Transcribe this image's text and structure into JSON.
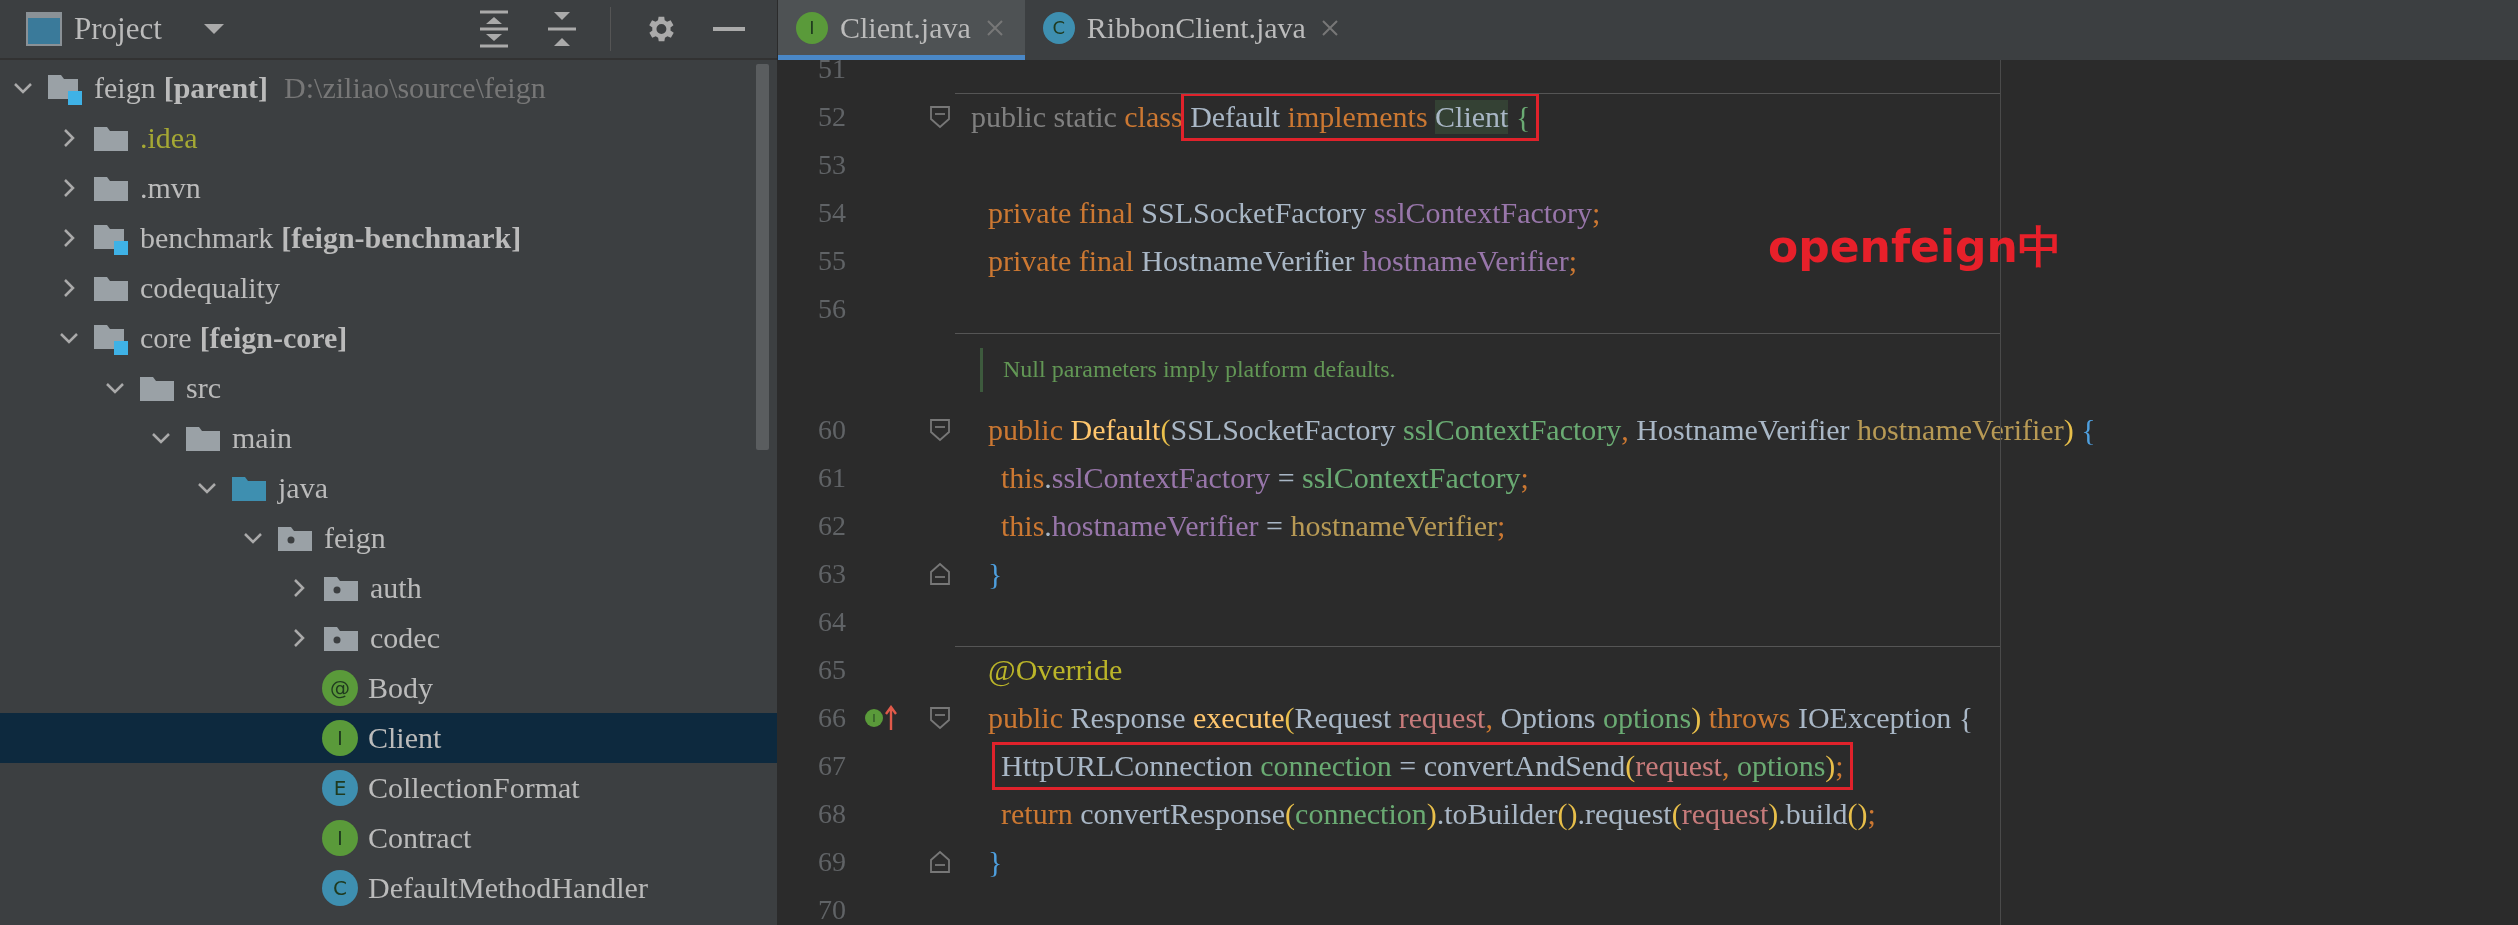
{
  "project_panel": {
    "title": "Project",
    "tree": [
      {
        "name": "feign",
        "module": "[parent]",
        "path": "D:\\ziliao\\source\\feign",
        "kind": "module",
        "expanded": true,
        "selected": false,
        "ignored": false,
        "children": [
          {
            "name": ".idea",
            "kind": "folder",
            "expanded": false,
            "selected": false,
            "ignored": true
          },
          {
            "name": ".mvn",
            "kind": "folder",
            "expanded": false,
            "selected": false,
            "ignored": false
          },
          {
            "name": "benchmark",
            "module": "[feign-benchmark]",
            "kind": "module",
            "expanded": false,
            "selected": false,
            "ignored": false
          },
          {
            "name": "codequality",
            "kind": "folder",
            "expanded": false,
            "selected": false,
            "ignored": false
          },
          {
            "name": "core",
            "module": "[feign-core]",
            "kind": "module",
            "expanded": true,
            "selected": false,
            "ignored": false,
            "children": [
              {
                "name": "src",
                "kind": "folder",
                "expanded": true,
                "selected": false,
                "ignored": false,
                "children": [
                  {
                    "name": "main",
                    "kind": "folder",
                    "expanded": true,
                    "selected": false,
                    "ignored": false,
                    "children": [
                      {
                        "name": "java",
                        "kind": "source_root",
                        "expanded": true,
                        "selected": false,
                        "ignored": false,
                        "children": [
                          {
                            "name": "feign",
                            "kind": "package",
                            "expanded": true,
                            "selected": false,
                            "ignored": false,
                            "children": [
                              {
                                "name": "auth",
                                "kind": "package",
                                "expanded": false,
                                "selected": false,
                                "ignored": false
                              },
                              {
                                "name": "codec",
                                "kind": "package",
                                "expanded": false,
                                "selected": false,
                                "ignored": false
                              },
                              {
                                "name": "Body",
                                "kind": "annotation",
                                "badge": "@",
                                "selected": false,
                                "ignored": false
                              },
                              {
                                "name": "Client",
                                "kind": "interface",
                                "badge": "I",
                                "selected": true,
                                "ignored": false
                              },
                              {
                                "name": "CollectionFormat",
                                "kind": "enum",
                                "badge": "E",
                                "selected": false,
                                "ignored": false
                              },
                              {
                                "name": "Contract",
                                "kind": "interface",
                                "badge": "I",
                                "selected": false,
                                "ignored": false
                              },
                              {
                                "name": "DefaultMethodHandler",
                                "kind": "class",
                                "badge": "C",
                                "selected": false,
                                "ignored": false
                              }
                            ]
                          }
                        ]
                      }
                    ]
                  }
                ]
              }
            ]
          }
        ]
      }
    ]
  },
  "editor": {
    "tabs": [
      {
        "label": "Client.java",
        "badge": "I",
        "kind": "interface",
        "selected": true
      },
      {
        "label": "RibbonClient.java",
        "badge": "C",
        "kind": "class",
        "selected": false
      }
    ],
    "note": "openfeign中",
    "lines": [
      {
        "number": "51",
        "kind": "blank"
      },
      {
        "number": "52",
        "kind": "declaration",
        "separator": true,
        "fold_start": true,
        "fold_end": false,
        "segments": [
          {
            "boxed": false,
            "tokens": [
              {
                "text": "public static ",
                "kind": "dim"
              },
              {
                "text": "class ",
                "kind": "keyword"
              }
            ]
          },
          {
            "boxed": true,
            "tokens": [
              {
                "text": "Default ",
                "kind": "plain"
              },
              {
                "text": "implements ",
                "kind": "keyword"
              },
              {
                "text": "Client",
                "kind": "usage"
              },
              {
                "text": " {",
                "kind": "brace_green"
              }
            ]
          }
        ]
      },
      {
        "number": "53",
        "kind": "blank",
        "separator": false
      },
      {
        "number": "54",
        "kind": "member",
        "separator": false,
        "segments": [
          {
            "boxed": false,
            "tokens": [
              {
                "text": "private final ",
                "kind": "keyword"
              },
              {
                "text": "SSLSocketFactory ",
                "kind": "plain"
              },
              {
                "text": "sslContextFactory",
                "kind": "field"
              },
              {
                "text": ";",
                "kind": "keyword"
              }
            ]
          }
        ]
      },
      {
        "number": "55",
        "kind": "member",
        "separator": false,
        "segments": [
          {
            "boxed": false,
            "tokens": [
              {
                "text": "private final ",
                "kind": "keyword"
              },
              {
                "text": "HostnameVerifier ",
                "kind": "plain"
              },
              {
                "text": "hostnameVerifier",
                "kind": "field"
              },
              {
                "text": ";",
                "kind": "keyword"
              }
            ]
          }
        ]
      },
      {
        "number": "56",
        "kind": "blank",
        "separator": false
      },
      {
        "kind": "doc",
        "separator": true,
        "text": "Null parameters imply platform defaults."
      },
      {
        "number": "60",
        "kind": "member",
        "separator": false,
        "fold_start": true,
        "fold_end": false,
        "segments": [
          {
            "boxed": false,
            "tokens": [
              {
                "text": "public ",
                "kind": "keyword"
              },
              {
                "text": "Default",
                "kind": "method"
              },
              {
                "text": "(",
                "kind": "bracket"
              },
              {
                "text": "SSLSocketFactory ",
                "kind": "plain"
              },
              {
                "text": "sslContextFactory",
                "kind": "green"
              },
              {
                "text": ", ",
                "kind": "keyword"
              },
              {
                "text": "HostnameVerifier ",
                "kind": "plain"
              },
              {
                "text": "hostnameVerifier",
                "kind": "gold"
              },
              {
                "text": ")",
                "kind": "bracket"
              },
              {
                "text": " {",
                "kind": "brace_blue"
              }
            ]
          }
        ]
      },
      {
        "number": "61",
        "kind": "statement",
        "separator": false,
        "segments": [
          {
            "boxed": false,
            "tokens": [
              {
                "text": "this",
                "kind": "keyword"
              },
              {
                "text": ".",
                "kind": "plain"
              },
              {
                "text": "sslContextFactory",
                "kind": "field"
              },
              {
                "text": " = ",
                "kind": "plain"
              },
              {
                "text": "sslContextFactory",
                "kind": "green"
              },
              {
                "text": ";",
                "kind": "keyword"
              }
            ]
          }
        ]
      },
      {
        "number": "62",
        "kind": "statement",
        "separator": false,
        "segments": [
          {
            "boxed": false,
            "tokens": [
              {
                "text": "this",
                "kind": "keyword"
              },
              {
                "text": ".",
                "kind": "plain"
              },
              {
                "text": "hostnameVerifier",
                "kind": "field"
              },
              {
                "text": " = ",
                "kind": "plain"
              },
              {
                "text": "hostnameVerifier",
                "kind": "gold"
              },
              {
                "text": ";",
                "kind": "keyword"
              }
            ]
          }
        ]
      },
      {
        "number": "63",
        "kind": "member",
        "separator": false,
        "fold_start": false,
        "fold_end": true,
        "segments": [
          {
            "boxed": false,
            "tokens": [
              {
                "text": "}",
                "kind": "brace_blue"
              }
            ]
          }
        ]
      },
      {
        "number": "64",
        "kind": "blank",
        "separator": false
      },
      {
        "number": "65",
        "kind": "member",
        "separator": true,
        "segments": [
          {
            "boxed": false,
            "tokens": [
              {
                "text": "@Override",
                "kind": "annotation"
              }
            ]
          }
        ]
      },
      {
        "number": "66",
        "kind": "member",
        "separator": false,
        "fold_start": true,
        "fold_end": false,
        "gutter_badge": "I",
        "segments": [
          {
            "boxed": false,
            "tokens": [
              {
                "text": "public ",
                "kind": "keyword"
              },
              {
                "text": "Response ",
                "kind": "plain"
              },
              {
                "text": "execute",
                "kind": "method"
              },
              {
                "text": "(",
                "kind": "bracket"
              },
              {
                "text": "Request ",
                "kind": "plain"
              },
              {
                "text": "request",
                "kind": "rose"
              },
              {
                "text": ", ",
                "kind": "keyword"
              },
              {
                "text": "Options ",
                "kind": "plain"
              },
              {
                "text": "options",
                "kind": "green"
              },
              {
                "text": ")",
                "kind": "bracket"
              },
              {
                "text": " throws ",
                "kind": "keyword"
              },
              {
                "text": "IOException {",
                "kind": "plain"
              }
            ]
          }
        ]
      },
      {
        "number": "67",
        "kind": "statement",
        "separator": false,
        "segments": [
          {
            "boxed": true,
            "tokens": [
              {
                "text": "HttpURLConnection ",
                "kind": "plain"
              },
              {
                "text": "connection",
                "kind": "green"
              },
              {
                "text": " = convertAndSend",
                "kind": "plain"
              },
              {
                "text": "(",
                "kind": "bracket"
              },
              {
                "text": "request",
                "kind": "rose"
              },
              {
                "text": ", ",
                "kind": "keyword"
              },
              {
                "text": "options",
                "kind": "green"
              },
              {
                "text": ")",
                "kind": "bracket"
              },
              {
                "text": ";",
                "kind": "keyword"
              }
            ]
          }
        ]
      },
      {
        "number": "68",
        "kind": "statement",
        "separator": false,
        "segments": [
          {
            "boxed": false,
            "tokens": [
              {
                "text": "return ",
                "kind": "keyword"
              },
              {
                "text": "convertResponse",
                "kind": "plain"
              },
              {
                "text": "(",
                "kind": "bracket"
              },
              {
                "text": "connection",
                "kind": "green"
              },
              {
                "text": ")",
                "kind": "bracket"
              },
              {
                "text": ".toBuilder",
                "kind": "plain"
              },
              {
                "text": "()",
                "kind": "bracket"
              },
              {
                "text": ".request",
                "kind": "plain"
              },
              {
                "text": "(",
                "kind": "bracket"
              },
              {
                "text": "request",
                "kind": "rose"
              },
              {
                "text": ")",
                "kind": "bracket"
              },
              {
                "text": ".build",
                "kind": "plain"
              },
              {
                "text": "()",
                "kind": "bracket"
              },
              {
                "text": ";",
                "kind": "keyword"
              }
            ]
          }
        ]
      },
      {
        "number": "69",
        "kind": "member",
        "separator": false,
        "fold_start": false,
        "fold_end": true,
        "segments": [
          {
            "boxed": false,
            "tokens": [
              {
                "text": "}",
                "kind": "brace_blue"
              }
            ]
          }
        ]
      },
      {
        "number": "70",
        "kind": "blank",
        "separator": false
      }
    ]
  }
}
